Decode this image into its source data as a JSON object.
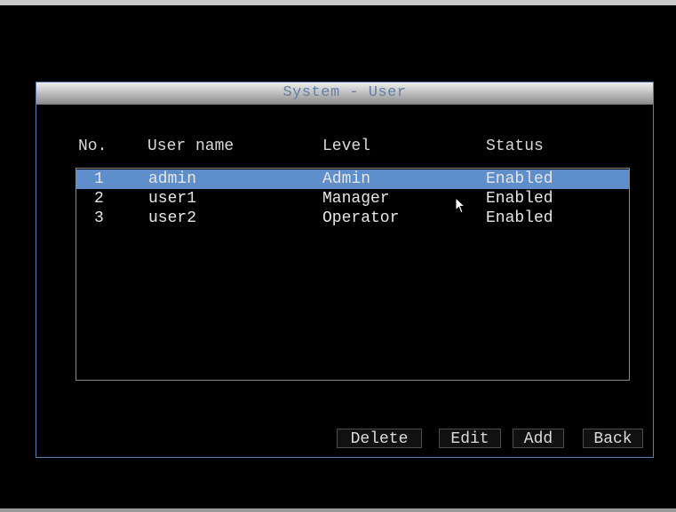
{
  "dialog": {
    "title": "System - User"
  },
  "table": {
    "headers": {
      "no": "No.",
      "username": "User name",
      "level": "Level",
      "status": "Status"
    },
    "rows": [
      {
        "no": "1",
        "username": "admin",
        "level": "Admin",
        "status": "Enabled",
        "selected": true
      },
      {
        "no": "2",
        "username": "user1",
        "level": "Manager",
        "status": "Enabled",
        "selected": false
      },
      {
        "no": "3",
        "username": "user2",
        "level": "Operator",
        "status": "Enabled",
        "selected": false
      }
    ]
  },
  "buttons": {
    "delete": "Delete",
    "edit": "Edit",
    "add": "Add",
    "back": "Back"
  },
  "colors": {
    "selection": "#5e8fcb",
    "title_text": "#5f7fa5",
    "dialog_border": "#5a7fa8",
    "background": "#000000"
  }
}
